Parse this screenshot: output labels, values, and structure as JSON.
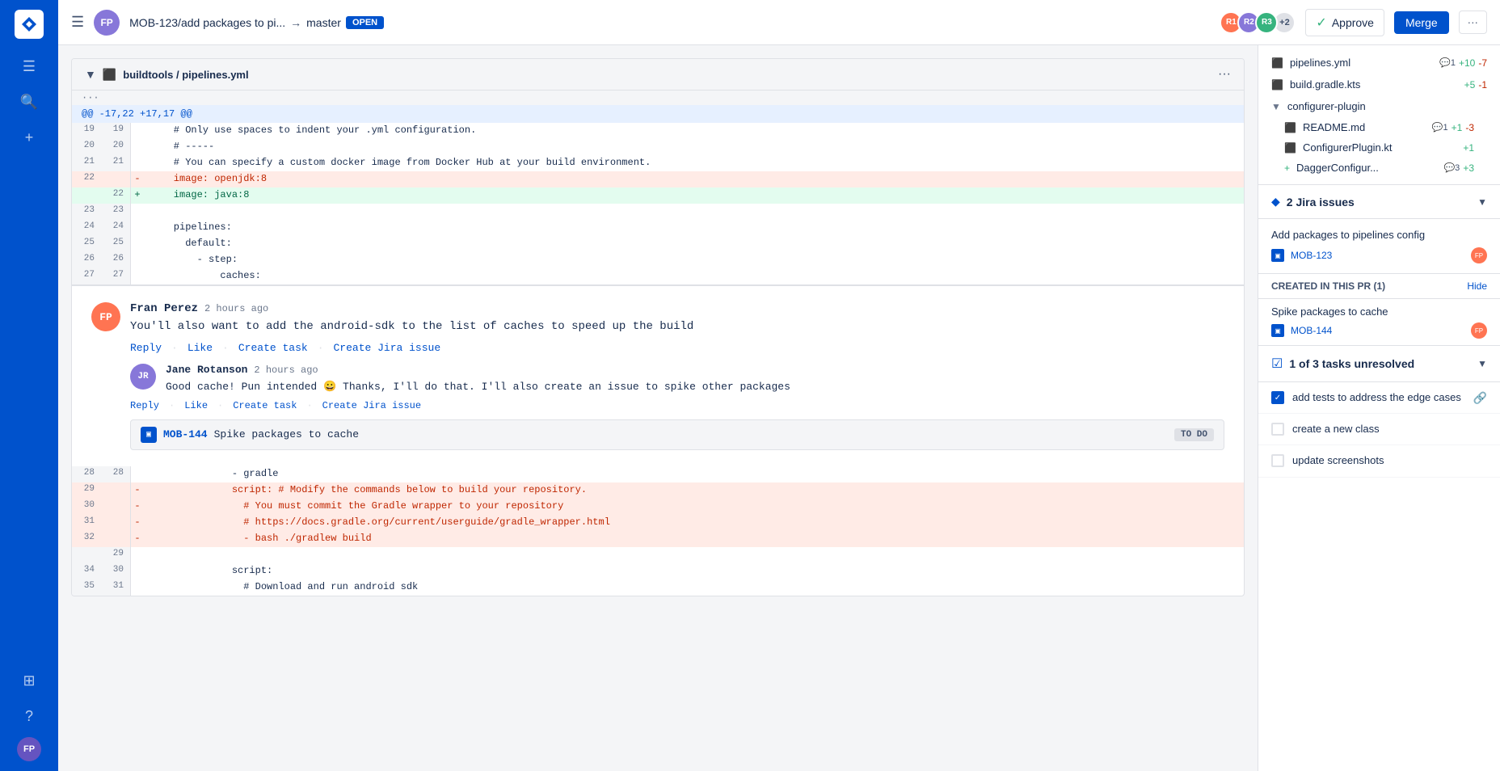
{
  "sidebar": {
    "logo_alt": "Bitbucket",
    "icons": [
      "☰",
      "🔍",
      "+",
      "⊞",
      "?"
    ],
    "user_initials": "FP"
  },
  "topbar": {
    "branch": "MOB-123/add packages to pi...",
    "arrow": "→",
    "target": "master",
    "status": "OPEN",
    "approve_label": "Approve",
    "merge_label": "Merge",
    "more_label": "···",
    "reviewers": [
      {
        "initials": "R1",
        "color": "#ff7452"
      },
      {
        "initials": "R2",
        "color": "#8777d9"
      },
      {
        "initials": "R3",
        "color": "#36b37e"
      }
    ],
    "reviewer_count": "+2"
  },
  "diff": {
    "file_path": "buildtools / pipelines.yml",
    "hunk_header": "@@ -17,22 +17,17 @@",
    "lines": [
      {
        "old": "19",
        "new": "19",
        "type": "context",
        "content": "    # Only use spaces to indent your .yml configuration."
      },
      {
        "old": "20",
        "new": "20",
        "type": "context",
        "content": "    # -----"
      },
      {
        "old": "21",
        "new": "21",
        "type": "context",
        "content": "    # You can specify a custom docker image from Docker Hub at your build environment."
      },
      {
        "old": "22",
        "new": "",
        "type": "removed",
        "content": "    image: openjdk:8"
      },
      {
        "old": "",
        "new": "22",
        "type": "added",
        "content": "    image: java:8"
      },
      {
        "old": "23",
        "new": "23",
        "type": "context",
        "content": ""
      },
      {
        "old": "24",
        "new": "24",
        "type": "context",
        "content": "    pipelines:"
      },
      {
        "old": "25",
        "new": "25",
        "type": "context",
        "content": "      default:"
      },
      {
        "old": "26",
        "new": "26",
        "type": "context",
        "content": "        - step:"
      },
      {
        "old": "27",
        "new": "27",
        "type": "context",
        "content": "            caches:"
      }
    ],
    "lines_after": [
      {
        "old": "28",
        "new": "28",
        "type": "context",
        "content": "              - gradle"
      },
      {
        "old": "29",
        "new": "",
        "type": "removed",
        "content": "              script: # Modify the commands below to build your repository."
      },
      {
        "old": "30",
        "new": "",
        "type": "removed",
        "content": "                # You must commit the Gradle wrapper to your repository"
      },
      {
        "old": "31",
        "new": "",
        "type": "removed",
        "content": "                # https://docs.gradle.org/current/userguide/gradle_wrapper.html"
      },
      {
        "old": "32",
        "new": "",
        "type": "removed",
        "content": "                - bash ./gradlew build"
      },
      {
        "old": "",
        "new": "29",
        "type": "context",
        "content": ""
      },
      {
        "old": "34",
        "new": "30",
        "type": "context",
        "content": "              script:"
      },
      {
        "old": "35",
        "new": "31",
        "type": "context",
        "content": "                # Download and run android sdk"
      }
    ]
  },
  "comment": {
    "author": "Fran Perez",
    "time": "2 hours ago",
    "text": "You'll also want to add the android-sdk to the list of caches to speed up the build",
    "actions": [
      "Reply",
      "Like",
      "Create task",
      "Create Jira issue"
    ],
    "initials": "FP",
    "color": "#ff7452"
  },
  "reply": {
    "author": "Jane Rotanson",
    "time": "2 hours ago",
    "text": "Good cache! Pun intended 😀 Thanks, I'll do that. I'll also create an issue to spike other packages",
    "actions": [
      "Reply",
      "Like",
      "Create task",
      "Create Jira issue"
    ],
    "initials": "JR",
    "color": "#8777d9",
    "jira_task": {
      "icon": "▣",
      "id": "MOB-144",
      "title": "Spike packages to cache",
      "status": "TO DO"
    }
  },
  "right_panel": {
    "files": [
      {
        "name": "pipelines.yml",
        "icon": "yellow",
        "comments": 1,
        "added": "+10",
        "removed": "-7"
      },
      {
        "name": "build.gradle.kts",
        "icon": "yellow",
        "added": "+5",
        "removed": "-1"
      },
      {
        "folder": "configurer-plugin",
        "children": [
          {
            "name": "README.md",
            "icon": "yellow",
            "comments": 1,
            "added": "+1",
            "removed": "-3"
          },
          {
            "name": "ConfigurerPlugin.kt",
            "icon": "yellow",
            "added": "+1"
          },
          {
            "name": "DaggerConfigur...",
            "icon": "green",
            "comments": 3,
            "added": "+3"
          }
        ]
      }
    ],
    "jira_section": {
      "title": "2 Jira issues",
      "issue1": {
        "title": "Add packages to pipelines config",
        "id": "MOB-123"
      },
      "created_in_pr": {
        "label": "CREATED IN THIS PR (1)",
        "hide": "Hide",
        "title": "Spike packages to cache",
        "id": "MOB-144"
      }
    },
    "tasks_section": {
      "title": "1 of 3 tasks unresolved",
      "tasks": [
        {
          "text": "add tests to address the edge cases",
          "checked": true,
          "linked": true
        },
        {
          "text": "create a new class",
          "checked": false,
          "linked": false
        },
        {
          "text": "update screenshots",
          "checked": false,
          "linked": false
        }
      ]
    }
  }
}
